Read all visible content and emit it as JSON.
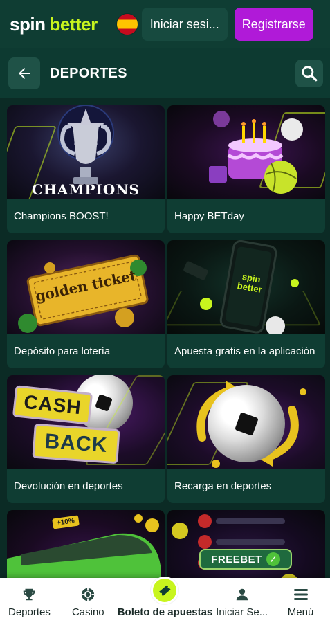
{
  "header": {
    "logo_part1": "spin",
    "logo_part2": "better",
    "language_flag": "spain-flag",
    "login_label": "Iniciar sesi...",
    "register_label": "Registrarse"
  },
  "section": {
    "title": "DEPORTES",
    "back_icon": "arrow-left-icon",
    "search_icon": "search-icon"
  },
  "promos": [
    {
      "label": "Champions BOOST!",
      "art_text": "CHAMPIONS",
      "art_icon": "trophy"
    },
    {
      "label": "Happy BETday",
      "art_icon": "birthday-cake"
    },
    {
      "label": "Depósito para lotería",
      "art_text": "golden ticket",
      "art_icon": "golden-ticket"
    },
    {
      "label": "Apuesta gratis en la aplicación",
      "art_text": "spin better",
      "art_icon": "smartphone"
    },
    {
      "label": "Devolución en deportes",
      "art_text1": "CASH",
      "art_text2": "BACK",
      "art_icon": "soccer-ball"
    },
    {
      "label": "Recarga en deportes",
      "art_icon": "soccer-ball"
    },
    {
      "label": "",
      "art_text": "+10%",
      "art_icon": "train"
    },
    {
      "label": "",
      "art_text": "FREEBET",
      "art_icon": "checklist"
    }
  ],
  "bottom_nav": [
    {
      "label": "Deportes",
      "icon": "trophy-icon"
    },
    {
      "label": "Casino",
      "icon": "poker-chip-icon"
    },
    {
      "label": "Boleto de apuestas",
      "icon": "ticket-icon"
    },
    {
      "label": "Iniciar Se...",
      "icon": "user-icon"
    },
    {
      "label": "Menú",
      "icon": "hamburger-icon"
    }
  ],
  "colors": {
    "brand_green": "#c8f51e",
    "register_purple": "#b01ad8",
    "background": "#0b2b25"
  }
}
